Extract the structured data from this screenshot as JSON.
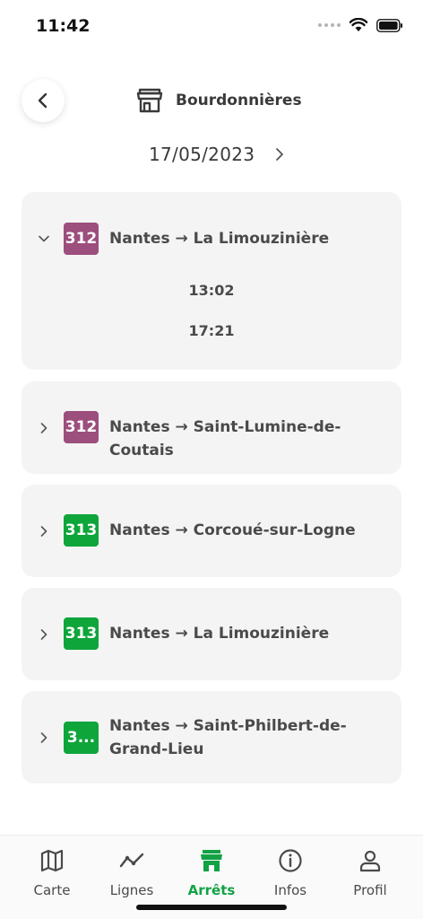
{
  "status": {
    "time": "11:42"
  },
  "header": {
    "stop_name": "Bourdonnières"
  },
  "date": {
    "value": "17/05/2023"
  },
  "lines": [
    {
      "number": "312",
      "color": "#9c4e7d",
      "destination": "Nantes → La Limouzinière",
      "expanded": true,
      "times": [
        "13:02",
        "17:21"
      ]
    },
    {
      "number": "312",
      "color": "#9c4e7d",
      "destination": "Nantes → Saint-Lumine-de-Coutais",
      "expanded": false
    },
    {
      "number": "313",
      "color": "#0ea53a",
      "destination": "Nantes → Corcoué-sur-Logne",
      "expanded": false
    },
    {
      "number": "313",
      "color": "#0ea53a",
      "destination": "Nantes → La Limouzinière",
      "expanded": false
    },
    {
      "number": "3...",
      "color": "#0ea53a",
      "destination": "Nantes → Saint-Philbert-de-Grand-Lieu",
      "expanded": false
    }
  ],
  "tabs": [
    {
      "label": "Carte",
      "icon": "map-icon"
    },
    {
      "label": "Lignes",
      "icon": "line-chart-icon"
    },
    {
      "label": "Arrêts",
      "icon": "store-icon",
      "active": true
    },
    {
      "label": "Infos",
      "icon": "info-icon"
    },
    {
      "label": "Profil",
      "icon": "user-icon"
    }
  ],
  "colors": {
    "accent": "#12a245",
    "card": "#f4f4f4"
  }
}
